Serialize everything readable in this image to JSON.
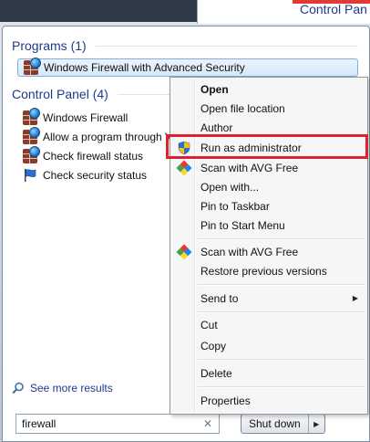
{
  "background_window": {
    "title": "Control Pan"
  },
  "programs": {
    "header": "Programs (1)",
    "items": [
      {
        "label": "Windows Firewall with Advanced Security",
        "icon": "firewall-icon"
      }
    ]
  },
  "control_panel": {
    "header": "Control Panel (4)",
    "items": [
      {
        "label": "Windows Firewall",
        "icon": "firewall-icon"
      },
      {
        "label": "Allow a program through Windows Firewall",
        "icon": "firewall-icon"
      },
      {
        "label": "Check firewall status",
        "icon": "firewall-icon"
      },
      {
        "label": "Check security status",
        "icon": "flag-icon"
      }
    ]
  },
  "see_more": "See more results",
  "search": {
    "value": "firewall",
    "clear": "✕"
  },
  "shutdown": {
    "label": "Shut down",
    "arrow": "▶"
  },
  "context_menu": {
    "items": [
      {
        "label": "Open",
        "bold": true
      },
      {
        "label": "Open file location"
      },
      {
        "label": "Author"
      },
      {
        "label": "Run as administrator",
        "icon": "uac-shield-icon",
        "highlighted": true
      },
      {
        "label": "Scan with AVG Free",
        "icon": "avg-icon"
      },
      {
        "label": "Open with..."
      },
      {
        "label": "Pin to Taskbar"
      },
      {
        "label": "Pin to Start Menu"
      },
      {
        "label": "Scan with AVG Free",
        "icon": "avg-icon"
      },
      {
        "label": "Restore previous versions"
      },
      {
        "label": "Send to",
        "submenu_arrow": "▶"
      },
      {
        "label": "Cut"
      },
      {
        "label": "Copy"
      },
      {
        "label": "Delete"
      },
      {
        "label": "Properties"
      }
    ]
  },
  "colors": {
    "highlight": "#e21f2d",
    "header_text": "#1e3a8a"
  }
}
